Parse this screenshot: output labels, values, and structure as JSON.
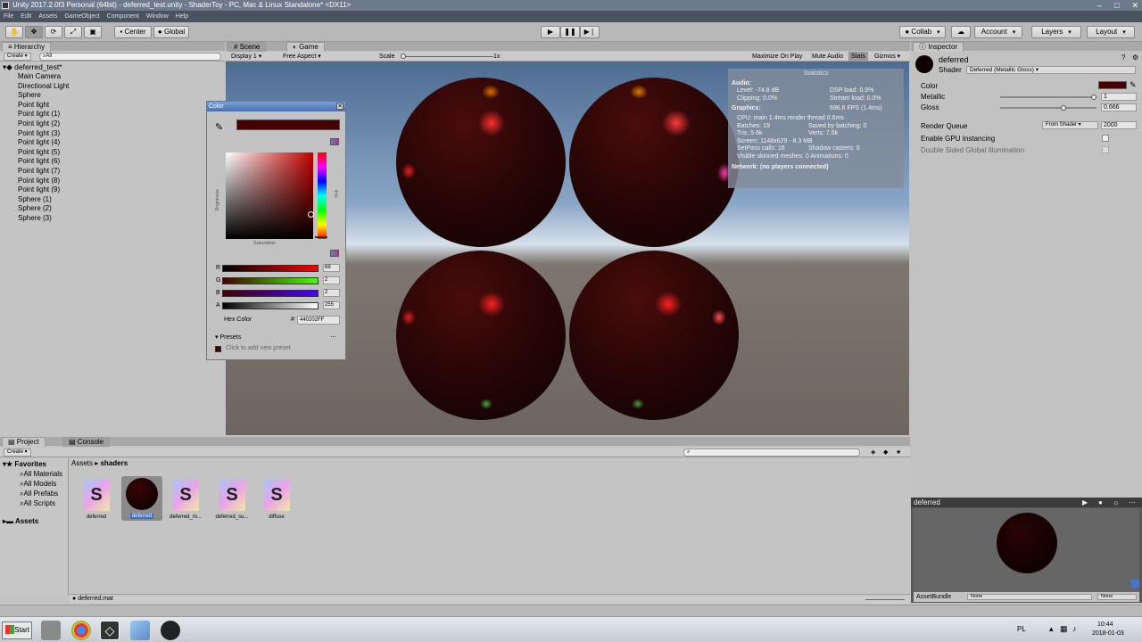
{
  "window": {
    "title": "Unity 2017.2.0f3 Personal (64bit) - deferred_test.unity - ShaderToy - PC, Mac & Linux Standalone* <DX11>"
  },
  "menu": [
    "File",
    "Edit",
    "Assets",
    "GameObject",
    "Component",
    "Window",
    "Help"
  ],
  "toolbar": {
    "center_label": "Center",
    "global_label": "Global",
    "collab_label": "Collab",
    "account_label": "Account",
    "layers_label": "Layers",
    "layout_label": "Layout"
  },
  "hierarchy": {
    "tab_label": "Hierarchy",
    "create_label": "Create",
    "search_placeholder": "All",
    "scene_name": "deferred_test*",
    "items": [
      "Main Camera",
      "Directional Light",
      "Sphere",
      "Point light",
      "Point light (1)",
      "Point light (2)",
      "Point light (3)",
      "Point light (4)",
      "Point light (5)",
      "Point light (6)",
      "Point light (7)",
      "Point light (8)",
      "Point light (9)",
      "Sphere (1)",
      "Sphere (2)",
      "Sphere (3)"
    ]
  },
  "view": {
    "scene_tab": "Scene",
    "game_tab": "Game",
    "display": "Display 1",
    "aspect": "Free Aspect",
    "scale_label": "Scale",
    "scale_value": "1x",
    "buttons": [
      "Maximize On Play",
      "Mute Audio",
      "Stats",
      "Gizmos"
    ]
  },
  "stats": {
    "title": "Statistics",
    "audio_header": "Audio:",
    "level": "Level: -74.8 dB",
    "clipping": "Clipping: 0.0%",
    "dsp": "DSP load: 0.9%",
    "stream": "Stream load: 0.0%",
    "graphics_header": "Graphics:",
    "fps": "696.6 FPS (1.4ms)",
    "cpu": "CPU: main 1.4ms  render thread 0.6ms",
    "batches": "Batches: 19",
    "saved": "Saved by batching: 0",
    "tris": "Tris: 5.6k",
    "verts": "Verts: 7.5k",
    "screen": "Screen: 1148x629 - 8.3 MB",
    "setpass": "SetPass calls: 16",
    "shadow": "Shadow casters: 0",
    "skinned": "Visible skinned meshes: 0  Animations: 0",
    "network": "Network: (no players connected)"
  },
  "color_picker": {
    "title": "Color",
    "saturation_label": "Saturation",
    "brightness_label": "Brightness",
    "hue_label": "Hue",
    "r_label": "R",
    "r_value": "68",
    "g_label": "G",
    "g_value": "2",
    "b_label": "B",
    "b_value": "2",
    "a_label": "A",
    "a_value": "255",
    "hex_label": "Hex Color",
    "hex_hash": "#",
    "hex_value": "440202FF",
    "presets_label": "Presets",
    "add_preset": "Click to add new preset",
    "swatch_color": "#440202"
  },
  "inspector": {
    "tab_label": "Inspector",
    "material_name": "deferred",
    "shader_label": "Shader",
    "shader_value": "Deferred (Metallic Gloss)",
    "color_label": "Color",
    "metallic_label": "Metallic",
    "metallic_value": "1",
    "metallic_level": 1.0,
    "gloss_label": "Gloss",
    "gloss_value": "0.666",
    "gloss_level": 0.666,
    "render_queue_label": "Render Queue",
    "render_queue_mode": "From Shader",
    "render_queue_value": "2000",
    "gpu_instancing_label": "Enable GPU Instancing",
    "double_sided_label": "Double Sided Global Illumination"
  },
  "preview": {
    "title": "deferred",
    "assetbundle_label": "AssetBundle",
    "bundle_value": "None",
    "variant_value": "None"
  },
  "project": {
    "tab_project": "Project",
    "tab_console": "Console",
    "create_label": "Create",
    "favorites_label": "Favorites",
    "favorites": [
      "All Materials",
      "All Models",
      "All Prefabs",
      "All Scripts"
    ],
    "assets_label": "Assets",
    "breadcrumb_root": "Assets",
    "breadcrumb_current": "shaders",
    "files": [
      "deferred",
      "deferred",
      "deferred_m...",
      "deferred_su...",
      "diffuse"
    ],
    "selected_path": "deferred.mat"
  },
  "taskbar": {
    "start_label": "Start",
    "lang": "PL",
    "time": "10:44",
    "date": "2018-01-03"
  }
}
